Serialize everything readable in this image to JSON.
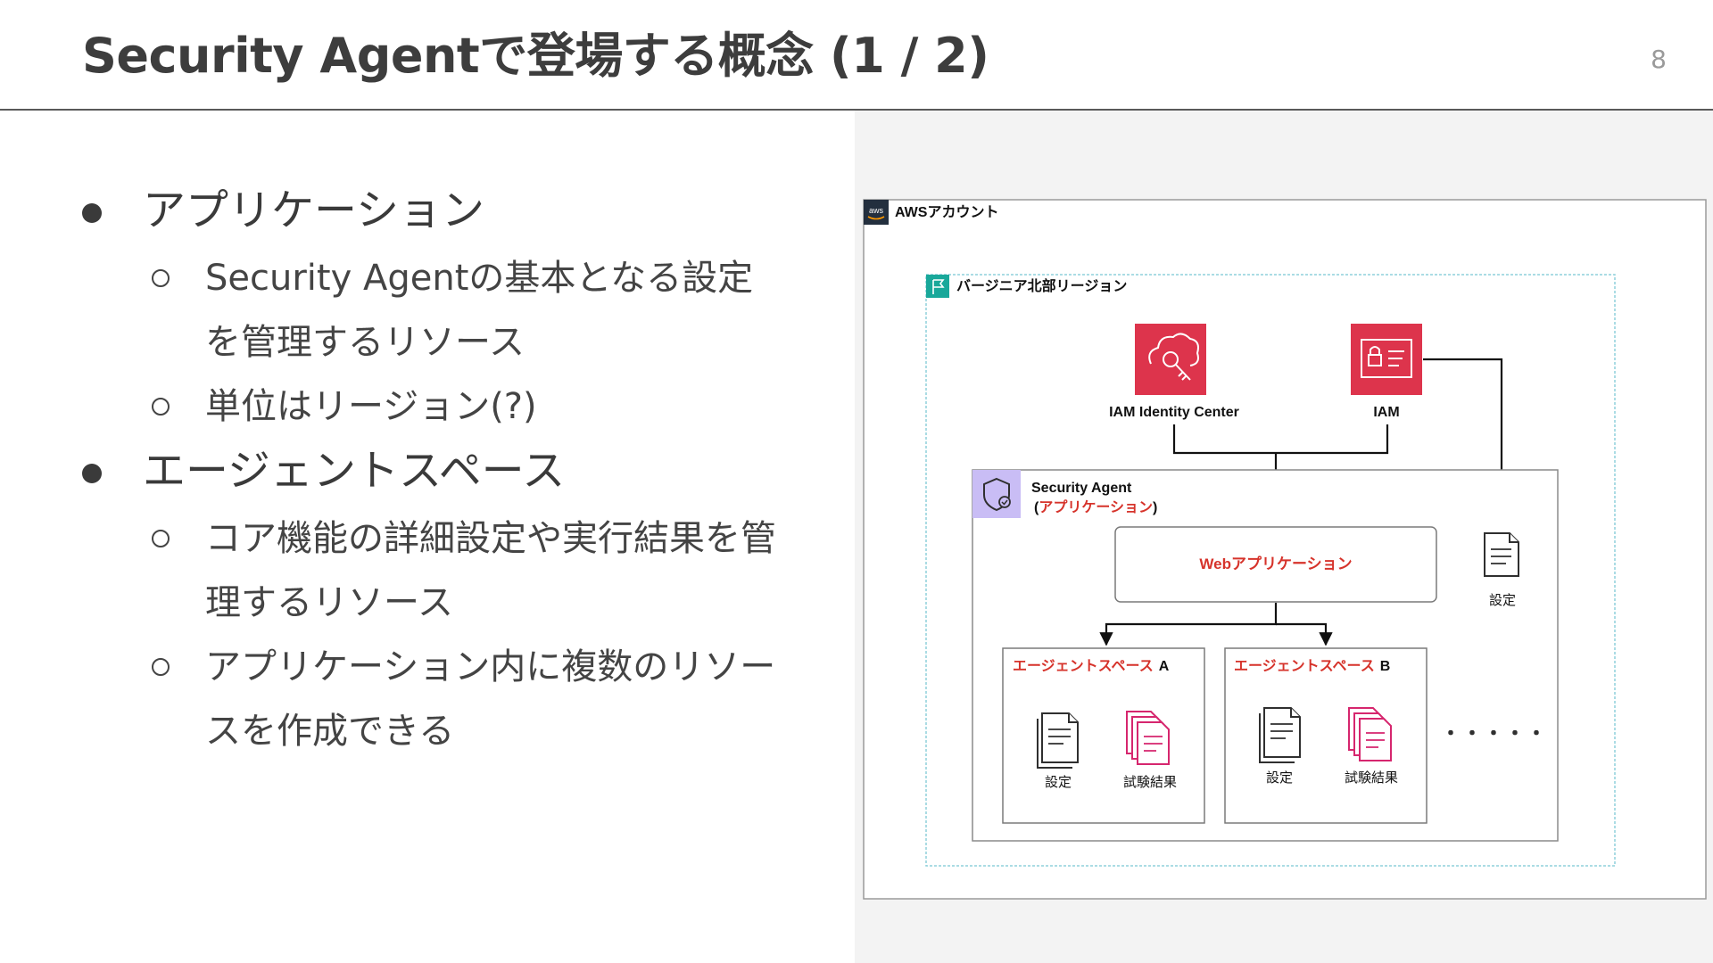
{
  "slide": {
    "title": "Security Agentで登場する概念 (1 / 2)",
    "page_number": "8"
  },
  "content": {
    "bullets": [
      {
        "text": "アプリケーション",
        "subs": [
          "Security Agentの基本となる設定を管理するリソース",
          "単位はリージョン(?)"
        ]
      },
      {
        "text": "エージェントスペース",
        "subs": [
          "コア機能の詳細設定や実行結果を管理するリソース",
          "アプリケーション内に複数のリソースを作成できる"
        ]
      }
    ]
  },
  "diagram": {
    "account_label": "AWSアカウント",
    "aws_logo_text": "aws",
    "region_label": "バージニア北部リージョン",
    "iam_identity_center_label": "IAM Identity Center",
    "iam_label": "IAM",
    "security_agent_label": "Security Agent",
    "application_paren_open": "(",
    "application_label": "アプリケーション",
    "application_paren_close": ")",
    "web_app_label": "Webアプリケーション",
    "settings_label": "設定",
    "space_a_name": "エージェントスペース",
    "space_a_suffix": "A",
    "space_a_settings": "設定",
    "space_a_results": "試験結果",
    "space_b_name": "エージェントスペース",
    "space_b_suffix": "B",
    "space_b_settings": "設定",
    "space_b_results": "試験結果",
    "ellipsis": "・・・・・",
    "colors": {
      "aws_red": "#dd344c",
      "purple_icon_bg": "#c9bdf5",
      "label_red": "#d6332b",
      "region_border": "#8fd1db",
      "region_flag": "#19a89a",
      "results_icon": "#d6266e"
    }
  }
}
